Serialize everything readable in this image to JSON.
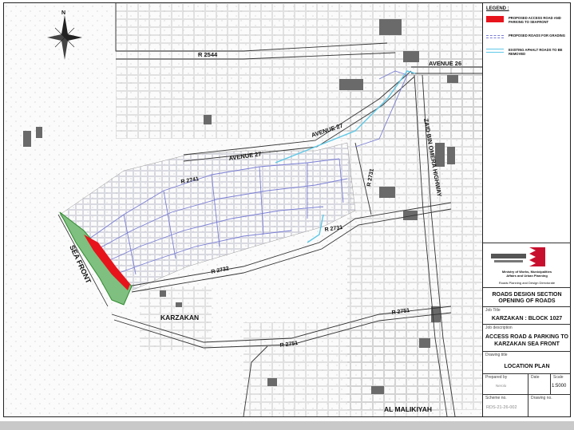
{
  "map": {
    "labels": {
      "north": "N",
      "r2544": "R 2544",
      "avenue26": "AVENUE 26",
      "avenue27_a": "AVENUE 27",
      "avenue27_b": "AVENUE 27",
      "r2741": "R 2741",
      "r2731_a": "R 2731",
      "r2731_b": "R 2731",
      "r2732": "R 2732",
      "r2751_a": "R 2751",
      "r2751_b": "R 2751",
      "highway": "ZAID BIN OMERA HIGHWAY",
      "sea_front": "SEA FRONT",
      "karzakan": "KARZAKAN",
      "al_malikiyah": "AL MALIKIYAH"
    },
    "colors": {
      "access_road": "#e8141c",
      "grading_roads": "#7b7fd4",
      "asphalt_remove": "#5fc8e6",
      "seafront_green": "#2f8a2f"
    }
  },
  "title_block": {
    "legend_title": "LEGEND :",
    "legend": [
      {
        "label": "PROPOSED ACCESS ROAD AND PARKING TO SEAFRONT",
        "color": "#e8141c"
      },
      {
        "label": "PROPOSED ROADS FOR GRADING",
        "color": "#7b7fd4"
      },
      {
        "label": "EXISTING APHALT ROADS TO BE REMOVED",
        "color": "#5fc8e6"
      }
    ],
    "ministry_line1": "Ministry of Works, Municipalities",
    "ministry_line2": "Affairs and Urban Planning",
    "directorate": "Roads Planning and Design Directorate",
    "section_line1": "ROADS DESIGN SECTION",
    "section_line2": "OPENING OF ROADS",
    "job_title_label": "Job Title",
    "job_title": "KARZAKAN : BLOCK 1027",
    "job_desc_label": "Job description",
    "job_desc_line1": "ACCESS ROAD & PARKING TO",
    "job_desc_line2": "KARZAKAN SEA FRONT",
    "drawing_title_label": "Drawing title",
    "drawing_title": "LOCATION PLAN",
    "prepared_by_label": "Prepared by",
    "prepared_by": "Nerolo",
    "date_label": "Date",
    "date": "",
    "scale_label": "Scale",
    "scale": "1:5000",
    "scheme_no_label": "Scheme no.",
    "scheme_no": "RDS-21-26-002",
    "drawing_no_label": "Drawing no.",
    "drawing_no": ""
  }
}
